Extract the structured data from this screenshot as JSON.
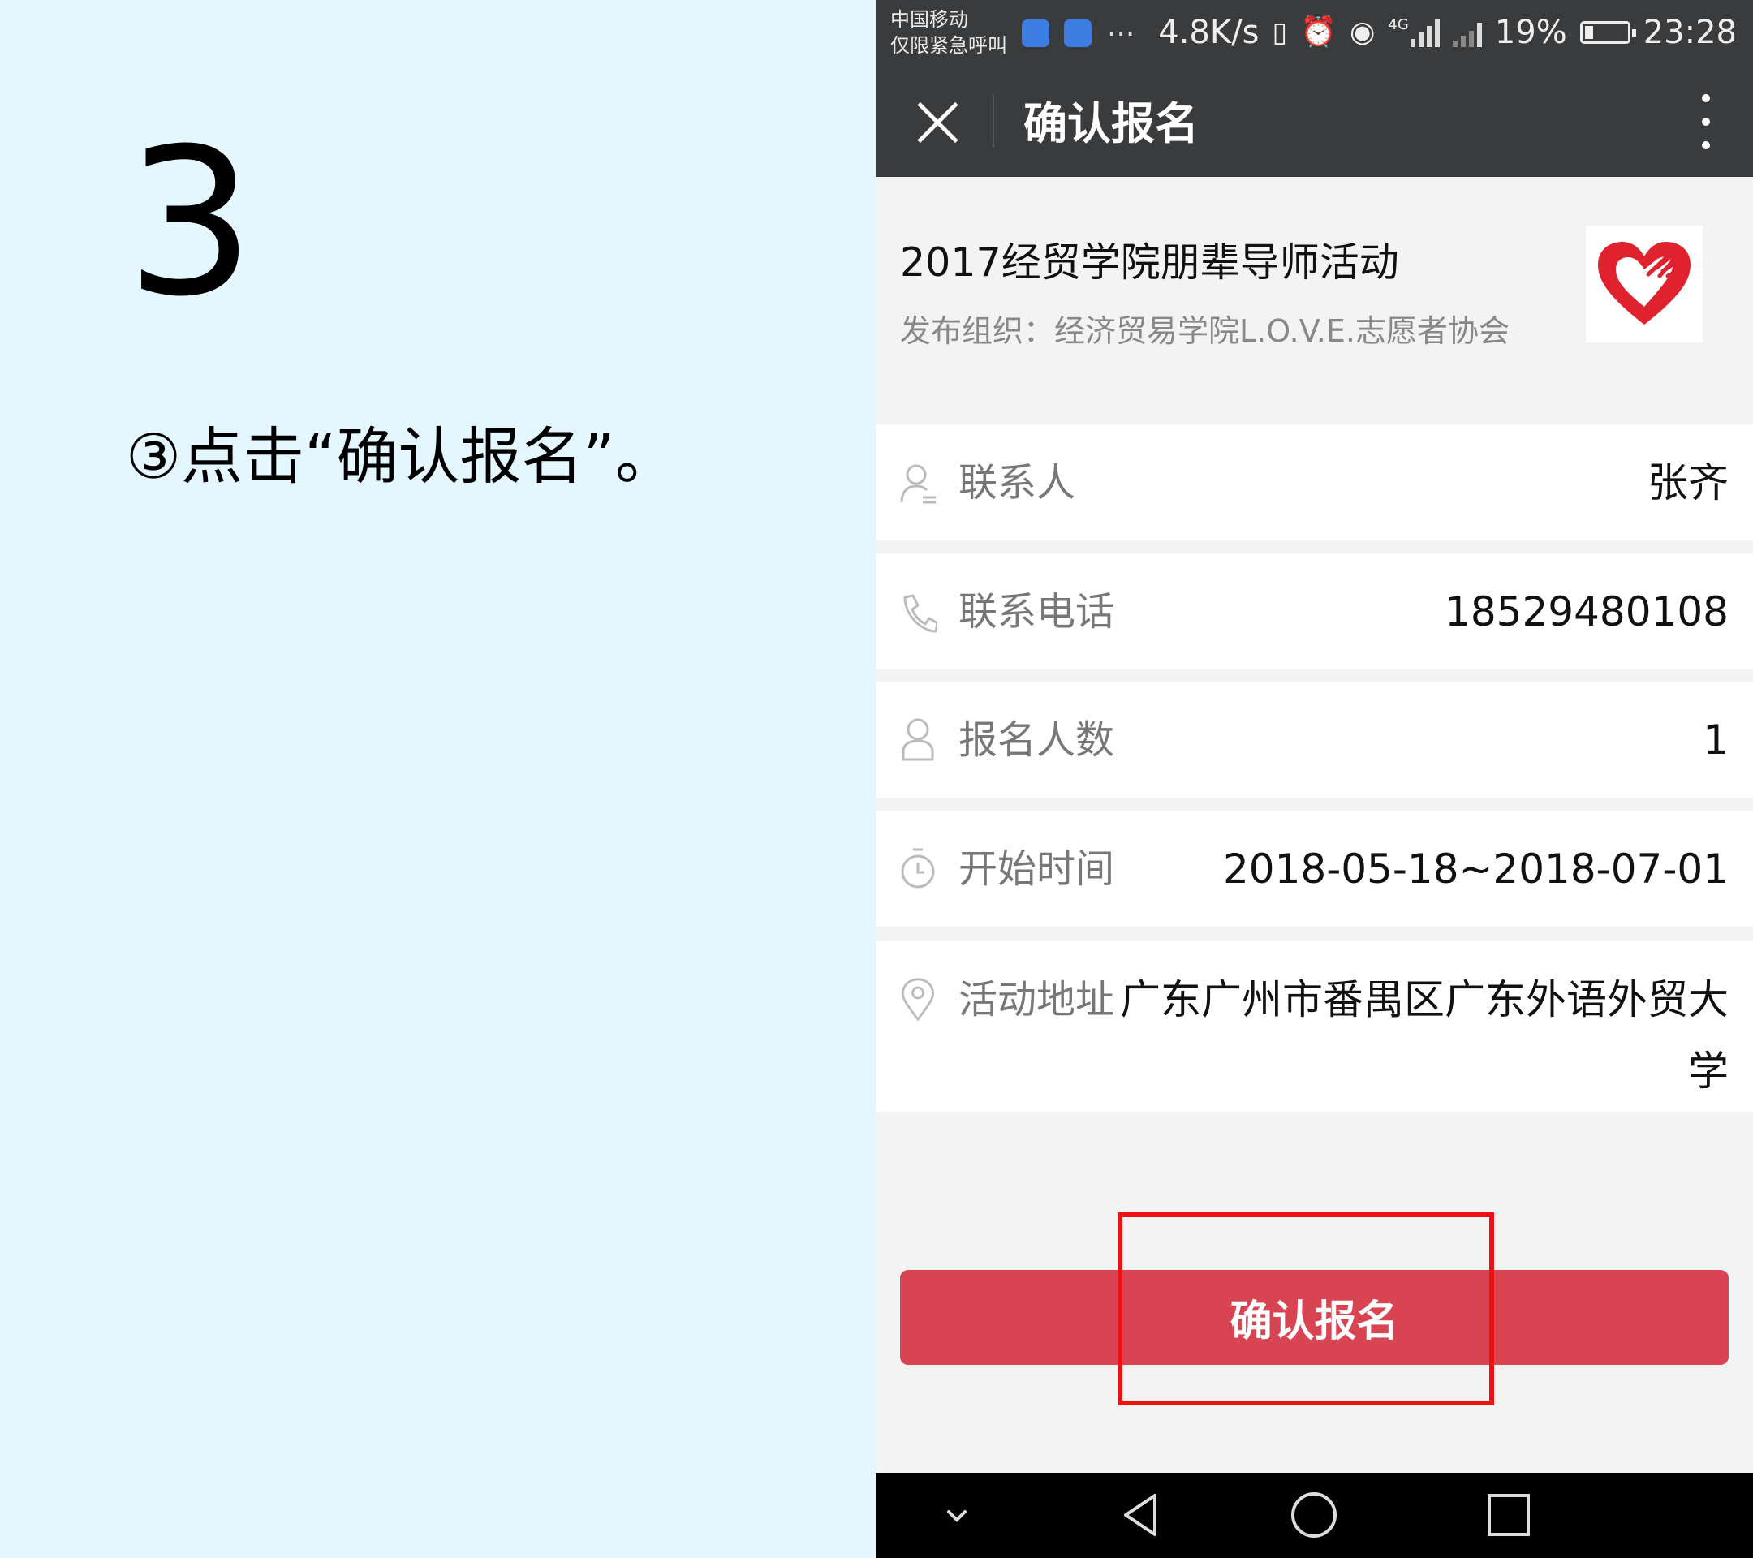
{
  "slide": {
    "step_number": "3",
    "instruction": "③点击“确认报名”。"
  },
  "status_bar": {
    "carrier": "中国移动",
    "carrier_sub": "仅限紧急呼叫",
    "net_speed": "4.8K/s",
    "network": "4G",
    "battery": "19%",
    "time": "23:28"
  },
  "nav": {
    "title": "确认报名"
  },
  "activity": {
    "title": "2017经贸学院朋辈导师活动",
    "org_label": "发布组织：",
    "org_name": "经济贸易学院L.O.V.E.志愿者协会"
  },
  "form": {
    "rows": [
      {
        "label": "联系人",
        "value": "张齐",
        "icon": "person-icon"
      },
      {
        "label": "联系电话",
        "value": "18529480108",
        "icon": "phone-icon"
      },
      {
        "label": "报名人数",
        "value": "1",
        "icon": "user-icon"
      },
      {
        "label": "开始时间",
        "value": "2018-05-18~2018-07-01",
        "icon": "timer-icon"
      },
      {
        "label": "活动地址",
        "value_line1": "广东广州市番禺区广东外语外贸大",
        "value_line2": "学",
        "icon": "location-pin-icon"
      }
    ]
  },
  "confirm_button": "确认报名",
  "colors": {
    "page_bg": "#e4f6fe",
    "bar_bg": "#3a3b3d",
    "button": "#d94452",
    "highlight": "#ee1111"
  }
}
